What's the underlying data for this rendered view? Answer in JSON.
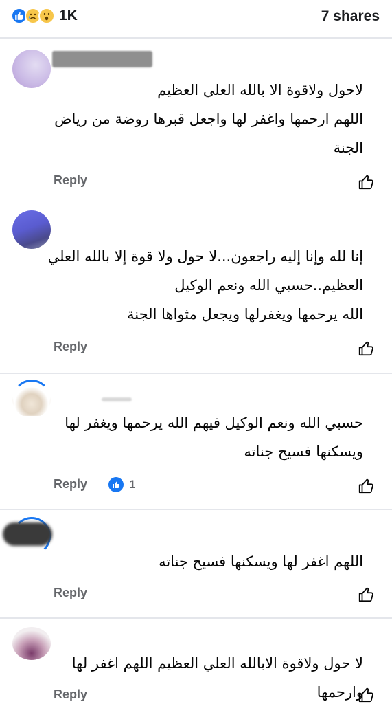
{
  "header": {
    "reaction_icons": [
      "like-icon",
      "sad-icon",
      "wow-icon"
    ],
    "reaction_count": "1K",
    "shares": "7 shares"
  },
  "colors": {
    "accent": "#1877f2",
    "secondary_text": "#65676b",
    "divider": "#e4e6eb"
  },
  "comments": [
    {
      "lines": [
        "لاحول ولاقوة الا بالله العلي العظيم",
        "اللهم ارحمها واغفر لها واجعل قبرها روضة من رياض",
        "الجنة"
      ],
      "reply": "Reply"
    },
    {
      "lines": [
        "إنا لله وإنا إليه راجعون...لا حول ولا قوة إلا بالله العلي",
        "العظيم..حسبي الله ونعم الوكيل",
        "الله يرحمها ويغفرلها ويجعل مثواها الجنة"
      ],
      "reply": "Reply"
    },
    {
      "lines": [
        "حسبي الله ونعم الوكيل فيهم الله يرحمها ويغفر لها",
        "ويسكنها فسيح جناته"
      ],
      "reply": "Reply",
      "reaction_count": "1"
    },
    {
      "lines": [
        "اللهم اغفر لها ويسكنها فسيح جناته"
      ],
      "reply": "Reply"
    },
    {
      "lines": [
        "لا حول ولاقوة الابالله العلي العظيم اللهم اغفر لها وارحمها"
      ],
      "reply": "Reply"
    }
  ]
}
